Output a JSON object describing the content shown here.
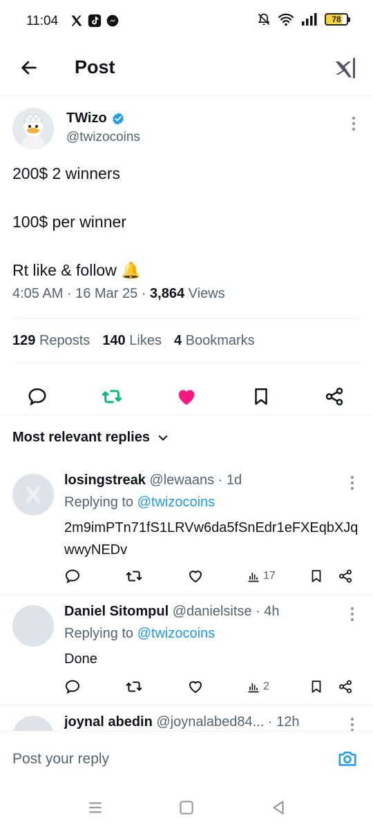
{
  "status_bar": {
    "time": "11:04",
    "battery": "78",
    "apps": [
      "x-icon",
      "tiktok-icon",
      "messenger-icon"
    ],
    "indicators": [
      "mute-icon",
      "wifi-icon",
      "signal-icon"
    ]
  },
  "header": {
    "title": "Post"
  },
  "post": {
    "author_name": "TWizo",
    "author_handle": "@twizocoins",
    "verified": true,
    "lines": [
      "200$ 2 winners",
      "100$ per winner",
      "Rt like & follow 🔔"
    ],
    "time": "4:05 AM",
    "date": "16 Mar 25",
    "views_count": "3,864",
    "views_label": "Views",
    "reposts_count": "129",
    "reposts_label": "Reposts",
    "likes_count": "140",
    "likes_label": "Likes",
    "bookmarks_count": "4",
    "bookmarks_label": "Bookmarks",
    "colors": {
      "repost": "#00ba7c",
      "like": "#f91880",
      "link": "#1d9bf0",
      "muted": "#536471"
    }
  },
  "replies_header": "Most relevant replies",
  "replies": [
    {
      "name": "losingstreak",
      "handle": "@lewaans",
      "time": "· 1d",
      "replying_prefix": "Replying to",
      "replying_to": "@twizocoins",
      "text": "2m9imPTn71fS1LRVw6da5fSnEdr1eFXEqbXJqwwyNEDv",
      "views": "17"
    },
    {
      "name": "Daniel Sitompul",
      "handle": "@danielsitse",
      "time": "· 4h",
      "replying_prefix": "Replying to",
      "replying_to": "@twizocoins",
      "text": "Done",
      "views": "2"
    },
    {
      "name": "joynal abedin",
      "handle": "@joynalabed84...",
      "time": "· 12h"
    }
  ],
  "compose": {
    "placeholder": "Post your reply"
  }
}
